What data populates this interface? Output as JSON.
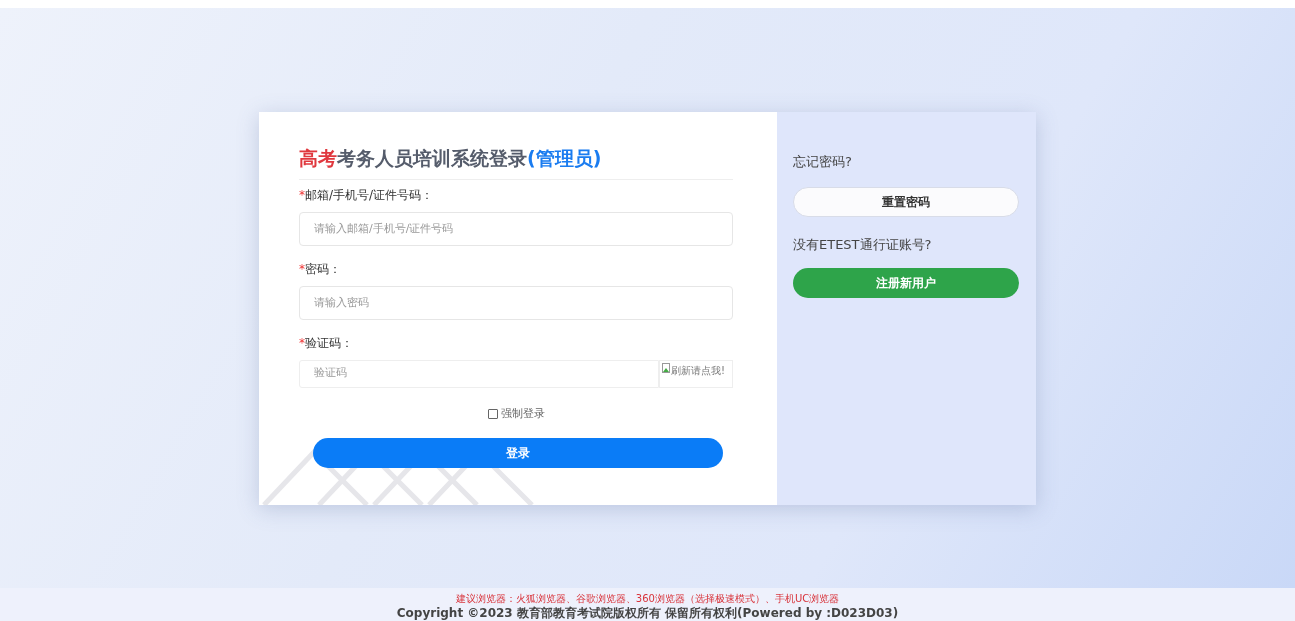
{
  "login": {
    "title": {
      "prefix": "高考",
      "main": "考务人员培训系统登录",
      "suffix": "(管理员)"
    },
    "fields": [
      {
        "required": "*",
        "label": "邮箱/手机号/证件号码：",
        "placeholder": "请输入邮箱/手机号/证件号码"
      },
      {
        "required": "*",
        "label": " 密码：",
        "placeholder": "请输入密码"
      }
    ],
    "captcha": {
      "required": "*",
      "label": "验证码：",
      "placeholder": "验证码",
      "image_alt": "刷新请点我!"
    },
    "force_login": {
      "label": "强制登录",
      "checked": false
    },
    "submit": "登录"
  },
  "side": {
    "forgot_text": "忘记密码?",
    "reset_button": "重置密码",
    "register_text": "没有ETEST通行证账号?",
    "register_button": "注册新用户"
  },
  "footer": {
    "browsers": "建议浏览器：火狐浏览器、谷歌浏览器、360浏览器（选择极速模式）、手机UC浏览器",
    "copyright": "Copyright ©2023 教育部教育考试院版权所有 保留所有权利(Powered by :D023D03)"
  }
}
